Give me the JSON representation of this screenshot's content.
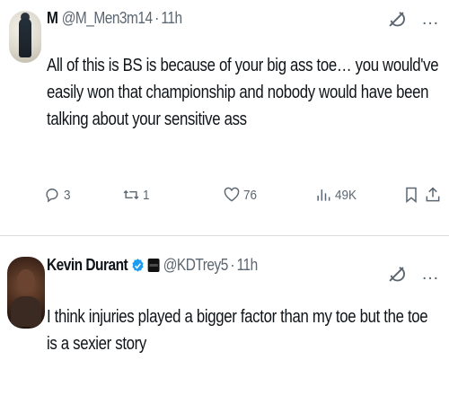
{
  "tweet1": {
    "name": "M",
    "handle": "@M_Men3m14",
    "separator": "·",
    "time": "11h",
    "text": "All of this is  BS is because of your big ass toe… you would've easily won that championship and nobody would have been talking about your sensitive ass",
    "actions": {
      "replies": "3",
      "retweets": "1",
      "likes": "76",
      "views": "49K"
    }
  },
  "tweet2": {
    "name": "Kevin Durant",
    "handle": "@KDTrey5",
    "separator": "·",
    "time": "11h",
    "text": "I think injuries played a bigger factor than my toe but the toe is a sexier story"
  },
  "icons": {
    "grok": "grok-icon",
    "more": "…",
    "reply": "reply-icon",
    "retweet": "retweet-icon",
    "like": "heart-icon",
    "views": "views-icon",
    "bookmark": "bookmark-icon",
    "share": "share-icon"
  },
  "colors": {
    "text": "#0f1419",
    "secondary": "#5b6670",
    "verified": "#1d9bf0"
  }
}
